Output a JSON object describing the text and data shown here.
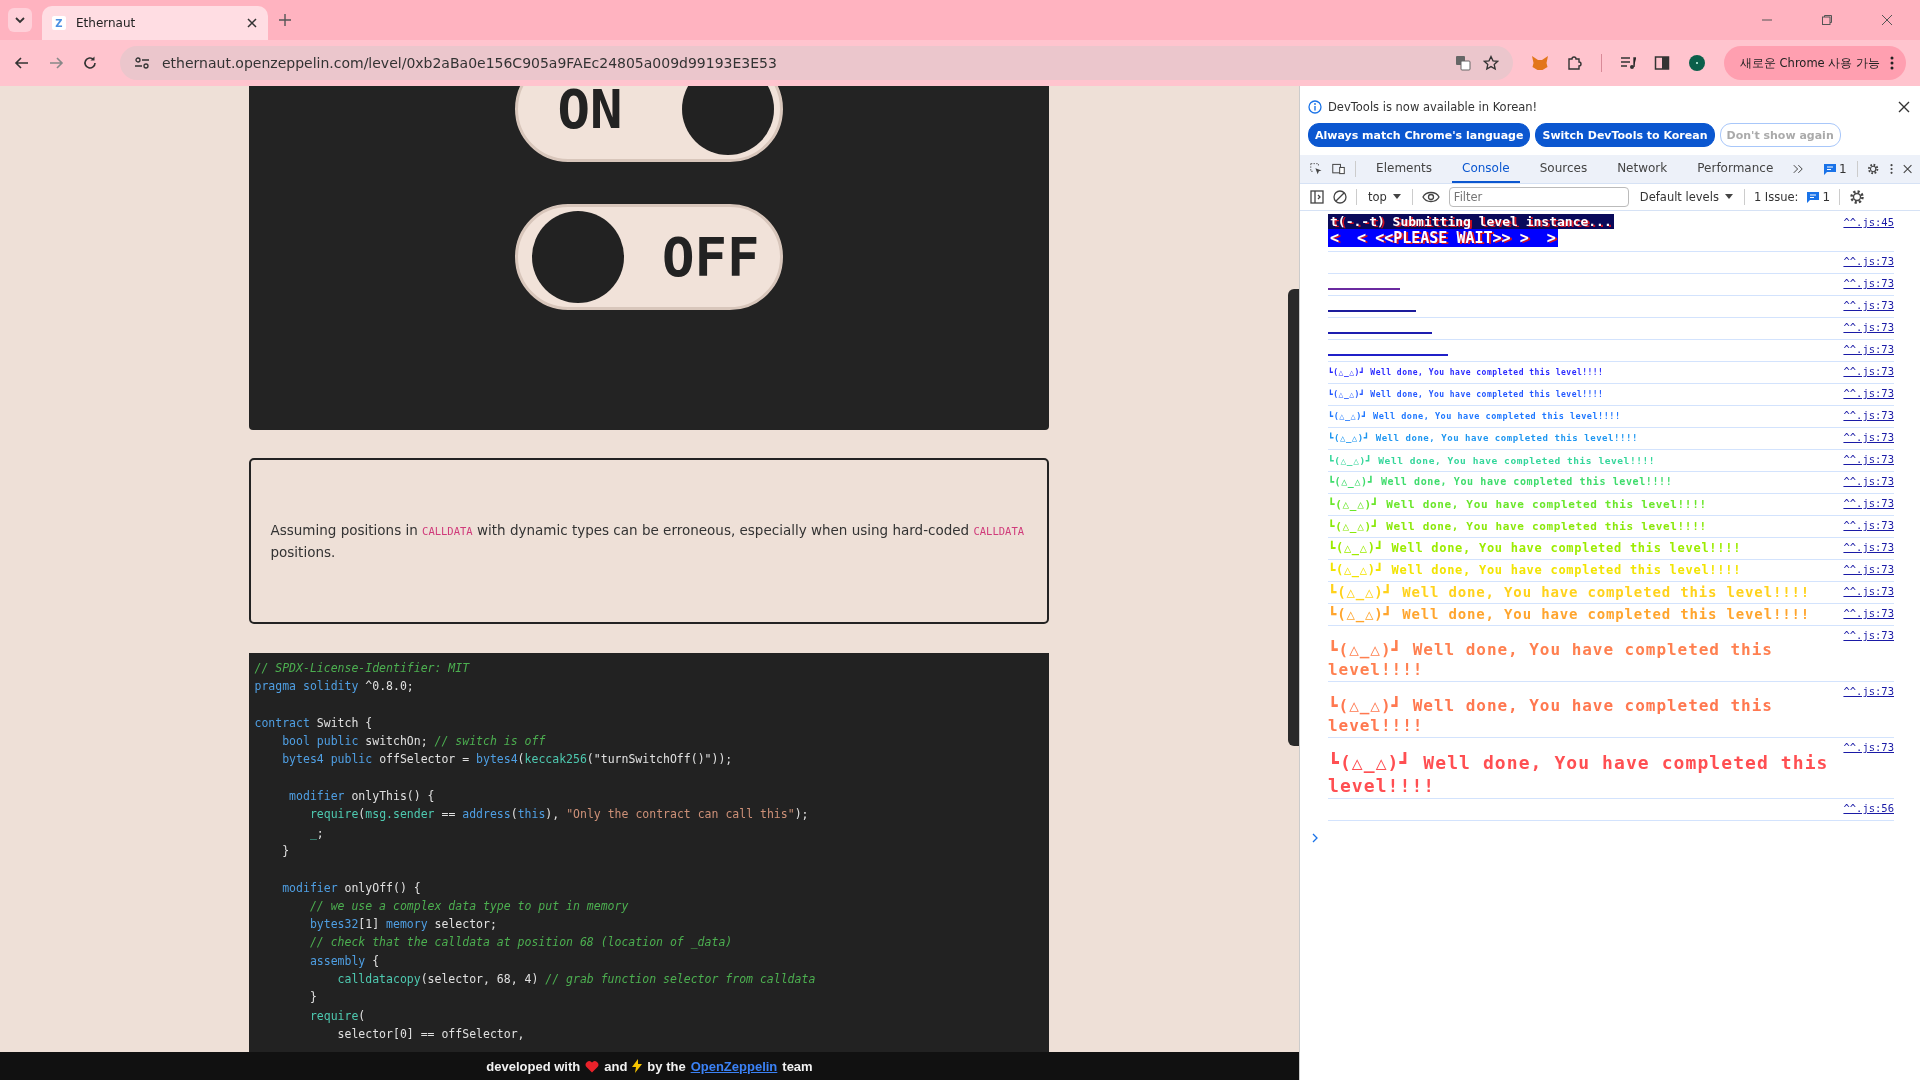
{
  "browser": {
    "tab": {
      "title": "Ethernaut",
      "favicon": "Z"
    },
    "url": "ethernaut.openzeppelin.com/level/0xb2aBa0e156C905a9FAEc24805a009d99193E3E53",
    "update_button": "새로운 Chrome 사용 가능"
  },
  "page": {
    "toggles": [
      {
        "label": "ON",
        "on": true
      },
      {
        "label": "OFF",
        "on": false
      }
    ],
    "note": [
      {
        "kind": "text",
        "text": "Assuming positions in "
      },
      {
        "kind": "code",
        "text": "CALLDATA"
      },
      {
        "kind": "text",
        "text": " with dynamic types can be erroneous, especially when using hard-coded "
      },
      {
        "kind": "code",
        "text": "CALLDATA"
      },
      {
        "kind": "text",
        "text": " positions."
      }
    ],
    "code": [
      {
        "kind": "code",
        "tokens": [
          {
            "kind": "cm",
            "t": "// SPDX-License-Identifier: MIT"
          }
        ]
      },
      {
        "kind": "code",
        "tokens": [
          {
            "kind": "kw",
            "t": "pragma solidity"
          },
          {
            "kind": "plain",
            "t": " ^0.8.0;"
          }
        ]
      },
      {
        "kind": "blank"
      },
      {
        "kind": "code",
        "tokens": [
          {
            "kind": "kw",
            "t": "contract"
          },
          {
            "kind": "plain",
            "t": " Switch {"
          }
        ]
      },
      {
        "kind": "code",
        "tokens": [
          {
            "kind": "kw",
            "t": "    bool public"
          },
          {
            "kind": "plain",
            "t": " switchOn; "
          },
          {
            "kind": "cm",
            "t": "// switch is off"
          }
        ]
      },
      {
        "kind": "code",
        "tokens": [
          {
            "kind": "kw",
            "t": "    bytes4 public"
          },
          {
            "kind": "plain",
            "t": " offSelector = "
          },
          {
            "kind": "kw",
            "t": "bytes4"
          },
          {
            "kind": "plain",
            "t": "("
          },
          {
            "kind": "fn",
            "t": "keccak256"
          },
          {
            "kind": "plain",
            "t": "(\"turnSwitchOff()\"));"
          }
        ]
      },
      {
        "kind": "blank"
      },
      {
        "kind": "code",
        "tokens": [
          {
            "kind": "kw",
            "t": "     modifier"
          },
          {
            "kind": "plain",
            "t": " onlyThis() {"
          }
        ]
      },
      {
        "kind": "code",
        "tokens": [
          {
            "kind": "fn",
            "t": "        require"
          },
          {
            "kind": "plain",
            "t": "("
          },
          {
            "kind": "fn",
            "t": "msg.sender"
          },
          {
            "kind": "plain",
            "t": " == "
          },
          {
            "kind": "kw",
            "t": "address"
          },
          {
            "kind": "plain",
            "t": "("
          },
          {
            "kind": "kw",
            "t": "this"
          },
          {
            "kind": "plain",
            "t": "), "
          },
          {
            "kind": "str",
            "t": "\"Only the contract can call this\""
          },
          {
            "kind": "plain",
            "t": ");"
          }
        ]
      },
      {
        "kind": "code",
        "tokens": [
          {
            "kind": "fn",
            "t": "        _"
          },
          {
            "kind": "plain",
            "t": ";"
          }
        ]
      },
      {
        "kind": "code",
        "tokens": [
          {
            "kind": "plain",
            "t": "    }"
          }
        ]
      },
      {
        "kind": "blank"
      },
      {
        "kind": "code",
        "tokens": [
          {
            "kind": "kw",
            "t": "    modifier"
          },
          {
            "kind": "plain",
            "t": " onlyOff() {"
          }
        ]
      },
      {
        "kind": "code",
        "tokens": [
          {
            "kind": "cm",
            "t": "        // we use a complex data type to put in memory"
          }
        ]
      },
      {
        "kind": "code",
        "tokens": [
          {
            "kind": "kw",
            "t": "        bytes32"
          },
          {
            "kind": "plain",
            "t": "[1] "
          },
          {
            "kind": "kw",
            "t": "memory"
          },
          {
            "kind": "plain",
            "t": " selector;"
          }
        ]
      },
      {
        "kind": "code",
        "tokens": [
          {
            "kind": "cm",
            "t": "        // check that the calldata at position 68 (location of _data)"
          }
        ]
      },
      {
        "kind": "code",
        "tokens": [
          {
            "kind": "kw",
            "t": "        assembly"
          },
          {
            "kind": "plain",
            "t": " {"
          }
        ]
      },
      {
        "kind": "code",
        "tokens": [
          {
            "kind": "fn",
            "t": "            calldatacopy"
          },
          {
            "kind": "plain",
            "t": "(selector, 68, 4) "
          },
          {
            "kind": "cm",
            "t": "// grab function selector from calldata"
          }
        ]
      },
      {
        "kind": "code",
        "tokens": [
          {
            "kind": "plain",
            "t": "        }"
          }
        ]
      },
      {
        "kind": "code",
        "tokens": [
          {
            "kind": "fn",
            "t": "        require"
          },
          {
            "kind": "plain",
            "t": "("
          }
        ]
      },
      {
        "kind": "code",
        "tokens": [
          {
            "kind": "plain",
            "t": "            selector[0] == offSelector,"
          }
        ]
      }
    ],
    "footer": {
      "before_heart": "developed with",
      "before_bolt": "and",
      "before_link": "by the",
      "link": "OpenZeppelin",
      "after_link": "team"
    }
  },
  "devtools": {
    "infobar": {
      "message": "DevTools is now available in Korean!",
      "buttons": [
        {
          "label": "Always match Chrome's language",
          "primary": true
        },
        {
          "label": "Switch DevTools to Korean",
          "primary": true
        },
        {
          "label": "Don't show again",
          "primary": false
        }
      ]
    },
    "tabs": [
      {
        "label": "Elements",
        "selected": false
      },
      {
        "label": "Console",
        "selected": true
      },
      {
        "label": "Sources",
        "selected": false
      },
      {
        "label": "Network",
        "selected": false
      },
      {
        "label": "Performance",
        "selected": false
      }
    ],
    "issues_badge": "1",
    "toolbar": {
      "context": "top",
      "filter_placeholder": "Filter",
      "levels": "Default levels",
      "issues_label": "1 Issue:",
      "issues_count": "1"
    },
    "messages": [
      {
        "kind": "banner",
        "lines": [
          "t(-.-t) Submitting level instance...",
          "<  < <<PLEASE WAIT>> >  >"
        ],
        "source": "^^.js:45"
      },
      {
        "kind": "blank",
        "source": "^^.js:73"
      },
      {
        "kind": "smear",
        "color": "#6a2aa0",
        "source": "^^.js:73"
      },
      {
        "kind": "smear",
        "color": "#1c1c9c",
        "source": "^^.js:73"
      },
      {
        "kind": "smear",
        "color": "#1e1eb0",
        "source": "^^.js:73"
      },
      {
        "kind": "smear",
        "color": "#2020c8",
        "source": "^^.js:73"
      },
      {
        "kind": "text",
        "color": "#2a2aff",
        "text": "┗(△_△)┛ Well done, You have completed this level!!!!",
        "source": "^^.js:73"
      },
      {
        "kind": "text",
        "color": "#2358ff",
        "text": "┗(△_△)┛ Well done, You have completed this level!!!!",
        "source": "^^.js:73"
      },
      {
        "kind": "text",
        "color": "#1f78ff",
        "text": "┗(△_△)┛ Well done, You have completed this level!!!!",
        "source": "^^.js:73"
      },
      {
        "kind": "text",
        "color": "#1e96f0",
        "text": "┗(△_△)┛ Well done, You have completed this level!!!!",
        "source": "^^.js:73"
      },
      {
        "kind": "text",
        "color": "#33d69a",
        "text": "┗(△_△)┛ Well done, You have completed this level!!!!",
        "source": "^^.js:73"
      },
      {
        "kind": "text",
        "color": "#3fdc6c",
        "text": "┗(△_△)┛ Well done, You have completed this level!!!!",
        "source": "^^.js:73"
      },
      {
        "kind": "text",
        "color": "#6ae62a",
        "text": "┗(△_△)┛ Well done, You have completed this level!!!!",
        "source": "^^.js:73"
      },
      {
        "kind": "text",
        "color": "#8ae80a",
        "text": "┗(△_△)┛ Well done, You have completed this level!!!!",
        "source": "^^.js:73"
      },
      {
        "kind": "text",
        "color": "#9cec00",
        "text": "┗(△_△)┛ Well done, You have completed this level!!!!",
        "source": "^^.js:73"
      },
      {
        "kind": "text",
        "color": "#f2e400",
        "text": "┗(△_△)┛ Well done, You have completed this level!!!!",
        "source": "^^.js:73"
      },
      {
        "kind": "text",
        "color": "#ffd21c",
        "text": "┗(△_△)┛ Well done, You have completed this level!!!!",
        "source": "^^.js:73"
      },
      {
        "kind": "text",
        "color": "#ffa52e",
        "text": "┗(△_△)┛ Well done, You have completed this level!!!!",
        "source": "^^.js:73"
      },
      {
        "kind": "text",
        "color": "#ff8050",
        "text": "┗(△_△)┛ Well done, You have completed this level!!!!",
        "source": "^^.js:73"
      },
      {
        "kind": "text",
        "color": "#ff7850",
        "text": "┗(△_△)┛ Well done, You have completed this level!!!!",
        "source": "^^.js:73"
      },
      {
        "kind": "text",
        "color": "#ff4f52",
        "text": "┗(△_△)┛ Well done, You have completed this level!!!!",
        "source": "^^.js:73"
      },
      {
        "kind": "blank",
        "source": "^^.js:56"
      }
    ]
  }
}
